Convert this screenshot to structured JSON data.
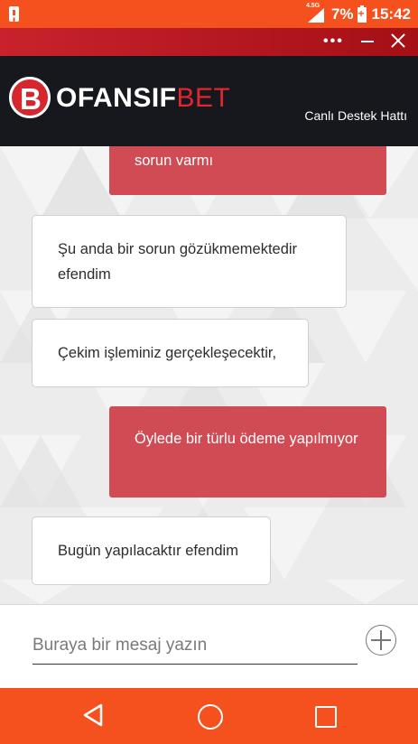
{
  "status_bar": {
    "network": "4.5G",
    "battery_percent": "7%",
    "time": "15:42",
    "color": "#f4511e"
  },
  "window_bar": {
    "more_icon": "more-dots-icon",
    "minimize_icon": "minimize-icon",
    "close_icon": "close-icon"
  },
  "header": {
    "logo_letter": "B",
    "logo_main": "OFANSIF",
    "logo_accent": "BET",
    "subtitle": "Canlı Destek Hattı",
    "brand_color": "#e0262f"
  },
  "chat": {
    "messages": [
      {
        "side": "out",
        "text": "sorun varmı"
      },
      {
        "side": "in",
        "text": "Şu anda bir sorun gözükmemektedir efendim"
      },
      {
        "side": "in",
        "text": "Çekim işleminiz gerçekleşecektir,"
      },
      {
        "side": "out",
        "text": "Öylede bir türlu ödeme yapılmıyor"
      },
      {
        "side": "in",
        "text": "Bugün yapılacaktır efendim"
      }
    ]
  },
  "composer": {
    "placeholder": "Buraya bir mesaj yazın",
    "value": "",
    "add_icon": "plus-circle-icon"
  },
  "nav_bar": {
    "back_icon": "back-triangle-icon",
    "home_icon": "home-circle-icon",
    "recents_icon": "recents-square-icon"
  }
}
